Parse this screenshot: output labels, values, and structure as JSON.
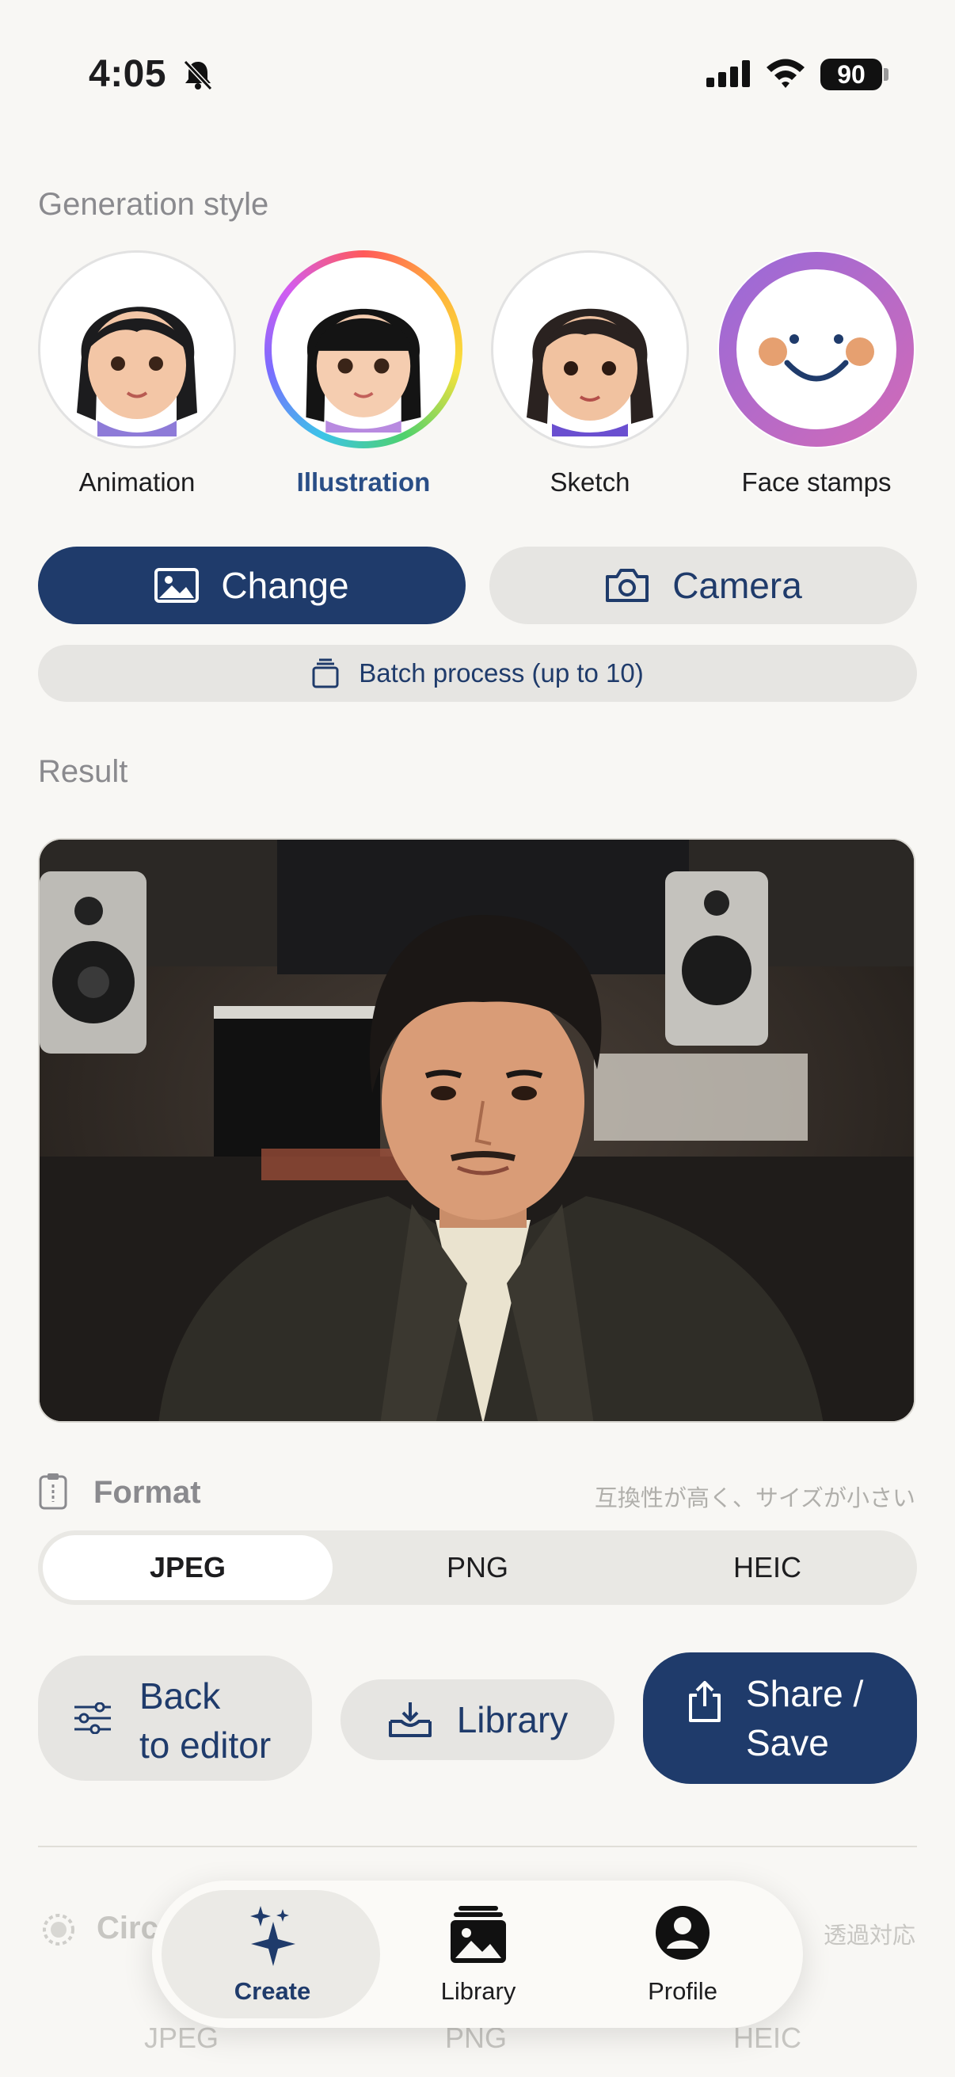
{
  "status": {
    "time": "4:05",
    "battery": "90"
  },
  "generation_style": {
    "title": "Generation style",
    "items": [
      {
        "label": "Animation"
      },
      {
        "label": "Illustration",
        "selected": true
      },
      {
        "label": "Sketch"
      },
      {
        "label": "Face stamps"
      }
    ]
  },
  "actions": {
    "change": "Change",
    "camera": "Camera",
    "batch": "Batch process (up to 10)"
  },
  "result": {
    "title": "Result"
  },
  "format": {
    "title": "Format",
    "hint": "互換性が高く、サイズが小さい",
    "options": [
      "JPEG",
      "PNG",
      "HEIC"
    ],
    "selected": "JPEG"
  },
  "bottom_actions": {
    "back_line1": "Back",
    "back_line2": "to editor",
    "library": "Library",
    "share_line1": "Share /",
    "share_line2": "Save"
  },
  "behind_nav": {
    "circle_title": "Circ",
    "transparent_hint": "透過対応",
    "options": [
      "JPEG",
      "PNG",
      "HEIC"
    ]
  },
  "nav": {
    "create": "Create",
    "library": "Library",
    "profile": "Profile"
  },
  "colors": {
    "primary": "#1f3b6b",
    "background": "#f8f7f4",
    "secondary": "#e6e5e2",
    "face_stamp": "#b46ad0"
  }
}
